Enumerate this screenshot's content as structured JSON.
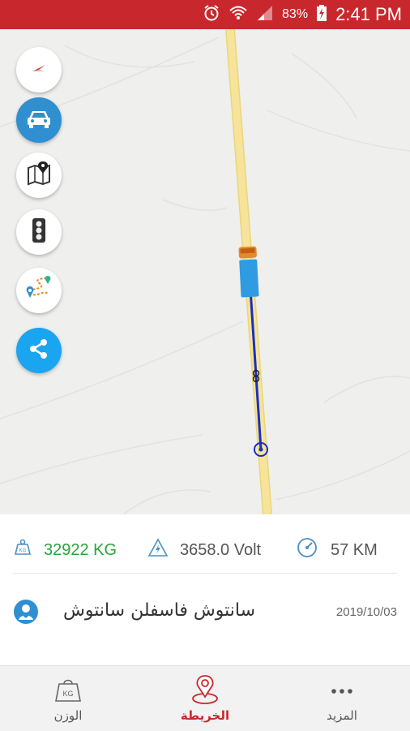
{
  "status_bar": {
    "battery_percent": "83%",
    "time": "2:41 PM",
    "color": "#c8282d"
  },
  "map": {
    "route_color": "#1a2fc4",
    "road_color": "#f7e39a",
    "buttons": [
      {
        "name": "compass-button",
        "icon": "compass-icon"
      },
      {
        "name": "vehicle-button",
        "icon": "car-icon"
      },
      {
        "name": "map-layer-button",
        "icon": "map-pin-icon"
      },
      {
        "name": "traffic-button",
        "icon": "traffic-light-icon"
      },
      {
        "name": "route-history-button",
        "icon": "route-icon"
      },
      {
        "name": "share-button",
        "icon": "share-icon"
      }
    ]
  },
  "info": {
    "weight": "32922 KG",
    "weight_color": "#2aa53a",
    "voltage": "3658.0 Volt",
    "distance": "57 KM",
    "driver_name": "سانتوش فاسفلن سانتوش",
    "date": "2019/10/03"
  },
  "tabs": [
    {
      "label": "الوزن",
      "icon": "kg-weight-icon",
      "active": false
    },
    {
      "label": "الخريطة",
      "icon": "map-location-icon",
      "active": true
    },
    {
      "label": "المزيد",
      "icon": "more-dots-icon",
      "active": false
    }
  ]
}
